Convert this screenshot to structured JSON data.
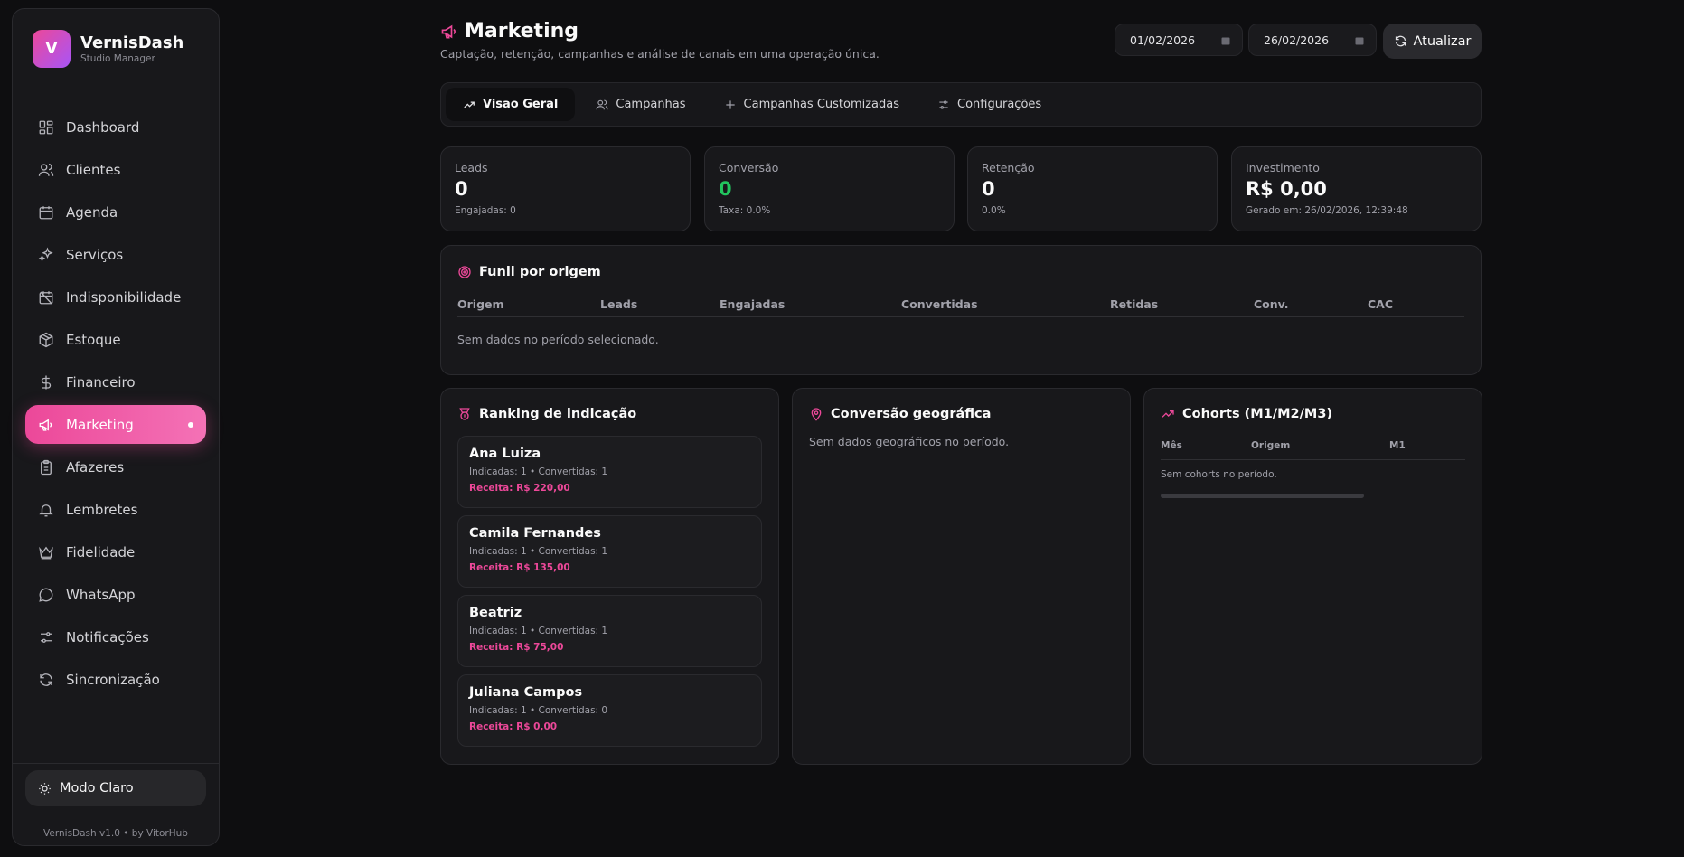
{
  "brand": {
    "logo_letter": "V",
    "name": "VernisDash",
    "subtitle": "Studio Manager"
  },
  "nav": [
    {
      "label": "Dashboard",
      "icon": "grid-icon"
    },
    {
      "label": "Clientes",
      "icon": "users-icon"
    },
    {
      "label": "Agenda",
      "icon": "calendar-icon"
    },
    {
      "label": "Serviços",
      "icon": "sparkles-icon"
    },
    {
      "label": "Indisponibilidade",
      "icon": "calendar-off-icon"
    },
    {
      "label": "Estoque",
      "icon": "package-icon"
    },
    {
      "label": "Financeiro",
      "icon": "dollar-icon"
    },
    {
      "label": "Marketing",
      "icon": "megaphone-icon",
      "active": true
    },
    {
      "label": "Afazeres",
      "icon": "clipboard-icon"
    },
    {
      "label": "Lembretes",
      "icon": "bell-icon"
    },
    {
      "label": "Fidelidade",
      "icon": "crown-icon"
    },
    {
      "label": "WhatsApp",
      "icon": "message-circle-icon"
    },
    {
      "label": "Notificações",
      "icon": "sliders-icon"
    },
    {
      "label": "Sincronização",
      "icon": "refresh-icon"
    }
  ],
  "theme_toggle": {
    "label": "Modo Claro",
    "icon": "sun-icon"
  },
  "version": "VernisDash v1.0 • by VitorHub",
  "header": {
    "title": "Marketing",
    "subtitle": "Captação, retenção, campanhas e análise de canais em uma operação única.",
    "date_from": "01/02/2026",
    "date_to": "26/02/2026",
    "refresh_label": "Atualizar"
  },
  "tabs": [
    {
      "label": "Visão Geral",
      "icon": "trending-up-icon",
      "active": true
    },
    {
      "label": "Campanhas",
      "icon": "users-icon"
    },
    {
      "label": "Campanhas Customizadas",
      "icon": "plus-icon"
    },
    {
      "label": "Configurações",
      "icon": "sliders-icon"
    }
  ],
  "kpis": [
    {
      "label": "Leads",
      "value": "0",
      "sub": "Engajadas: 0"
    },
    {
      "label": "Conversão",
      "value": "0",
      "sub": "Taxa: 0.0%",
      "color": "#22c55e"
    },
    {
      "label": "Retenção",
      "value": "0",
      "sub": "0.0%"
    },
    {
      "label": "Investimento",
      "value": "R$ 0,00",
      "sub": "Gerado em: 26/02/2026, 12:39:48"
    }
  ],
  "funnel": {
    "title": "Funil por origem",
    "columns": [
      "Origem",
      "Leads",
      "Engajadas",
      "Convertidas",
      "Retidas",
      "Conv.",
      "CAC"
    ],
    "empty": "Sem dados no período selecionado."
  },
  "ranking": {
    "title": "Ranking de indicação",
    "items": [
      {
        "name": "Ana Luiza",
        "stats": "Indicadas: 1 • Convertidas: 1",
        "revenue": "Receita: R$ 220,00"
      },
      {
        "name": "Camila Fernandes",
        "stats": "Indicadas: 1 • Convertidas: 1",
        "revenue": "Receita: R$ 135,00"
      },
      {
        "name": "Beatriz",
        "stats": "Indicadas: 1 • Convertidas: 1",
        "revenue": "Receita: R$ 75,00"
      },
      {
        "name": "Juliana Campos",
        "stats": "Indicadas: 1 • Convertidas: 0",
        "revenue": "Receita: R$ 0,00"
      }
    ]
  },
  "geo": {
    "title": "Conversão geográfica",
    "empty": "Sem dados geográficos no período."
  },
  "cohorts": {
    "title": "Cohorts (M1/M2/M3)",
    "columns": [
      "Mês",
      "Origem",
      "M1"
    ],
    "empty": "Sem cohorts no período."
  },
  "colors": {
    "accent": "#ec4899",
    "success": "#22c55e",
    "background": "#0e0e10",
    "card": "#18181b"
  }
}
